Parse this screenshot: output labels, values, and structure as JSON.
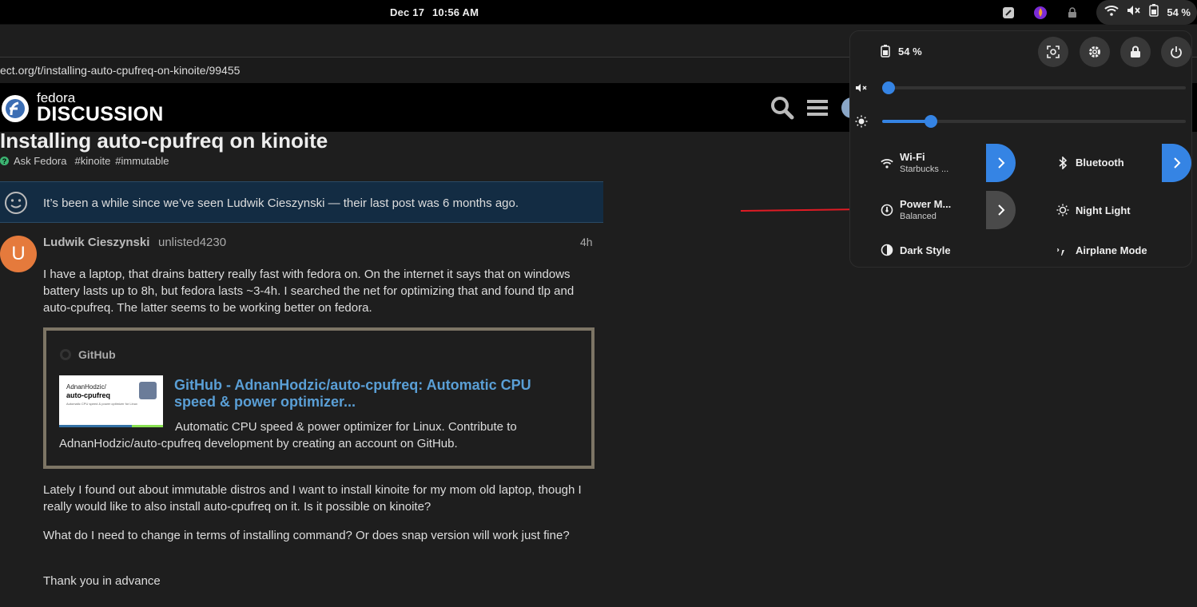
{
  "topbar": {
    "date": "Dec 17",
    "time": "10:56 AM",
    "battery_pct": "54 %"
  },
  "browser": {
    "url": "ect.org/t/installing-auto-cpufreq-on-kinoite/99455"
  },
  "site": {
    "logo_top": "fedora",
    "logo_bottom": "DISCUSSION"
  },
  "topic": {
    "title": "Installing auto-cpufreq on kinoite",
    "category": "Ask Fedora",
    "tags": [
      "#kinoite",
      "#immutable"
    ]
  },
  "notice": {
    "text": "It’s been a while since we’ve seen Ludwik Cieszynski — their last post was 6 months ago."
  },
  "post": {
    "avatar_letter": "U",
    "author": "Ludwik Cieszynski",
    "username": "unlisted4230",
    "time": "4h",
    "p1": "I have a laptop, that drains battery really fast with fedora on. On the internet it says that on windows battery lasts up to 8h, but fedora lasts ~3-4h. I searched the net for optimizing that and found tlp and auto-cpufreq. The latter seems to be working better on fedora.",
    "onebox": {
      "source": "GitHub",
      "thumb_line1": "AdnanHodzic/",
      "thumb_line2": "auto-cpufreq",
      "thumb_line3": "Automatic CPU speed & power optimizer for Linux",
      "title": "GitHub - AdnanHodzic/auto-cpufreq: Automatic CPU speed & power optimizer...",
      "description": "Automatic CPU speed & power optimizer for Linux. Contribute to AdnanHodzic/auto-cpufreq development by creating an account on GitHub."
    },
    "p2": "Lately I found out about immutable distros and I want to install kinoite for my mom old laptop, though I really would like to also install auto-cpufreq on it. Is it possible on kinoite?",
    "p3": "What do I need to change in terms of installing command? Or does snap version will work just fine?",
    "p4": "Thank you in advance"
  },
  "quick_settings": {
    "battery": "54 %",
    "volume_level": 0.0,
    "brightness_level": 0.16,
    "tiles": {
      "wifi": {
        "label": "Wi-Fi",
        "sub": "Starbucks ...",
        "active": true
      },
      "bluetooth": {
        "label": "Bluetooth",
        "active": true
      },
      "power": {
        "label": "Power M...",
        "sub": "Balanced"
      },
      "night_light": {
        "label": "Night Light"
      },
      "dark_style": {
        "label": "Dark Style"
      },
      "airplane": {
        "label": "Airplane Mode"
      }
    },
    "accent": "#3584e4"
  },
  "annotation": {
    "arrow_color": "#e01b24"
  }
}
